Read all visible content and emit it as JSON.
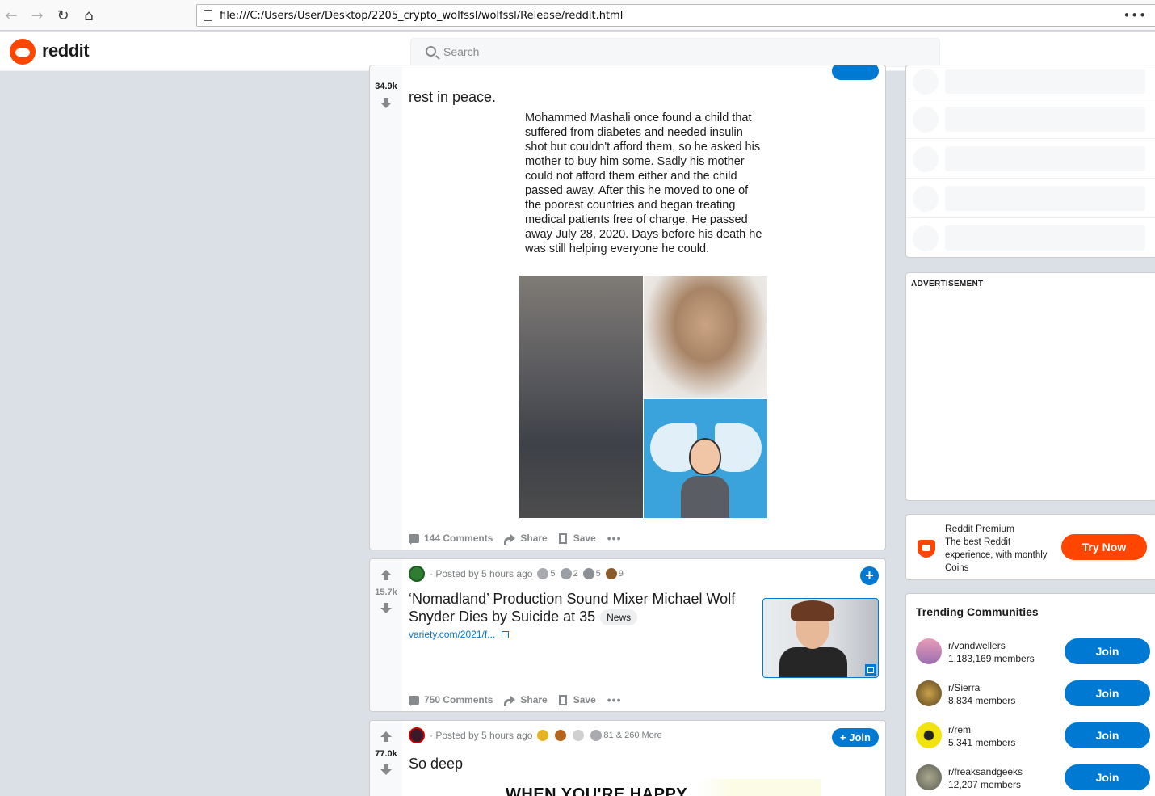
{
  "browser": {
    "url": "file:///C:/Users/User/Desktop/2205_crypto_wolfssl/wolfssl/Release/reddit.html",
    "more_label": "•••"
  },
  "header": {
    "logo_text": "reddit",
    "search_placeholder": "Search"
  },
  "posts": [
    {
      "score": "34.9k",
      "title": "rest in peace.",
      "image_text": "Mohammed Mashali once found a child that suffered from diabetes and needed insulin shot but couldn't afford them, so he asked his mother to buy him some. Sadly his mother could not afford them either and the child passed away. After this he moved to one of the poorest countries and began treating medical patients free of charge. He passed away July 28, 2020. Days before his death he was still helping everyone he could.",
      "comments": "144 Comments",
      "share": "Share",
      "save": "Save",
      "more": "•••"
    },
    {
      "score": "15.7k",
      "posted_by": "· Posted by 5 hours ago",
      "awards": [
        {
          "icon": "silver-award-icon",
          "count": "5",
          "color": "#a8aab0"
        },
        {
          "icon": "helpful-award-icon",
          "count": "2",
          "color": "#9aa0a6"
        },
        {
          "icon": "wholesome-award-icon",
          "count": "5",
          "color": "#8c8f94"
        },
        {
          "icon": "bear-award-icon",
          "count": "9",
          "color": "#8b5a2b"
        }
      ],
      "title": "‘Nomadland’ Production Sound Mixer Michael Wolf Snyder Dies by Suicide at 35",
      "flair": "News",
      "link": "variety.com/2021/f...",
      "comments": "750 Comments",
      "share": "Share",
      "save": "Save",
      "more": "•••",
      "plus": "+"
    },
    {
      "score": "77.0k",
      "posted_by": "· Posted by 5 hours ago",
      "awards": [
        {
          "icon": "gold-award-icon",
          "count": "",
          "color": "#e6b422"
        },
        {
          "icon": "burger-award-icon",
          "count": "",
          "color": "#b7651c"
        },
        {
          "icon": "f-award-icon",
          "count": "",
          "color": "#d0d0d0"
        },
        {
          "icon": "silver-award-icon",
          "count": "81 & 260 More",
          "color": "#a8aab0"
        }
      ],
      "title": "So deep",
      "join": "+ Join",
      "image_text": "WHEN YOU'RE HAPPY"
    }
  ],
  "sidebar": {
    "advertisement_label": "ADVERTISEMENT",
    "premium": {
      "title": "Reddit Premium",
      "description": "The best Reddit experience, with monthly Coins",
      "button": "Try Now"
    },
    "trending": {
      "title": "Trending Communities",
      "communities": [
        {
          "name": "r/vandwellers",
          "members": "1,183,169 members",
          "join": "Join",
          "color": "#d98aa8"
        },
        {
          "name": "r/Sierra",
          "members": "8,834 members",
          "join": "Join",
          "color": "#8a6d2e"
        },
        {
          "name": "r/rem",
          "members": "5,341 members",
          "join": "Join",
          "color": "#f2e30f"
        },
        {
          "name": "r/freaksandgeeks",
          "members": "12,207 members",
          "join": "Join",
          "color": "#7c7c6e"
        }
      ]
    }
  }
}
